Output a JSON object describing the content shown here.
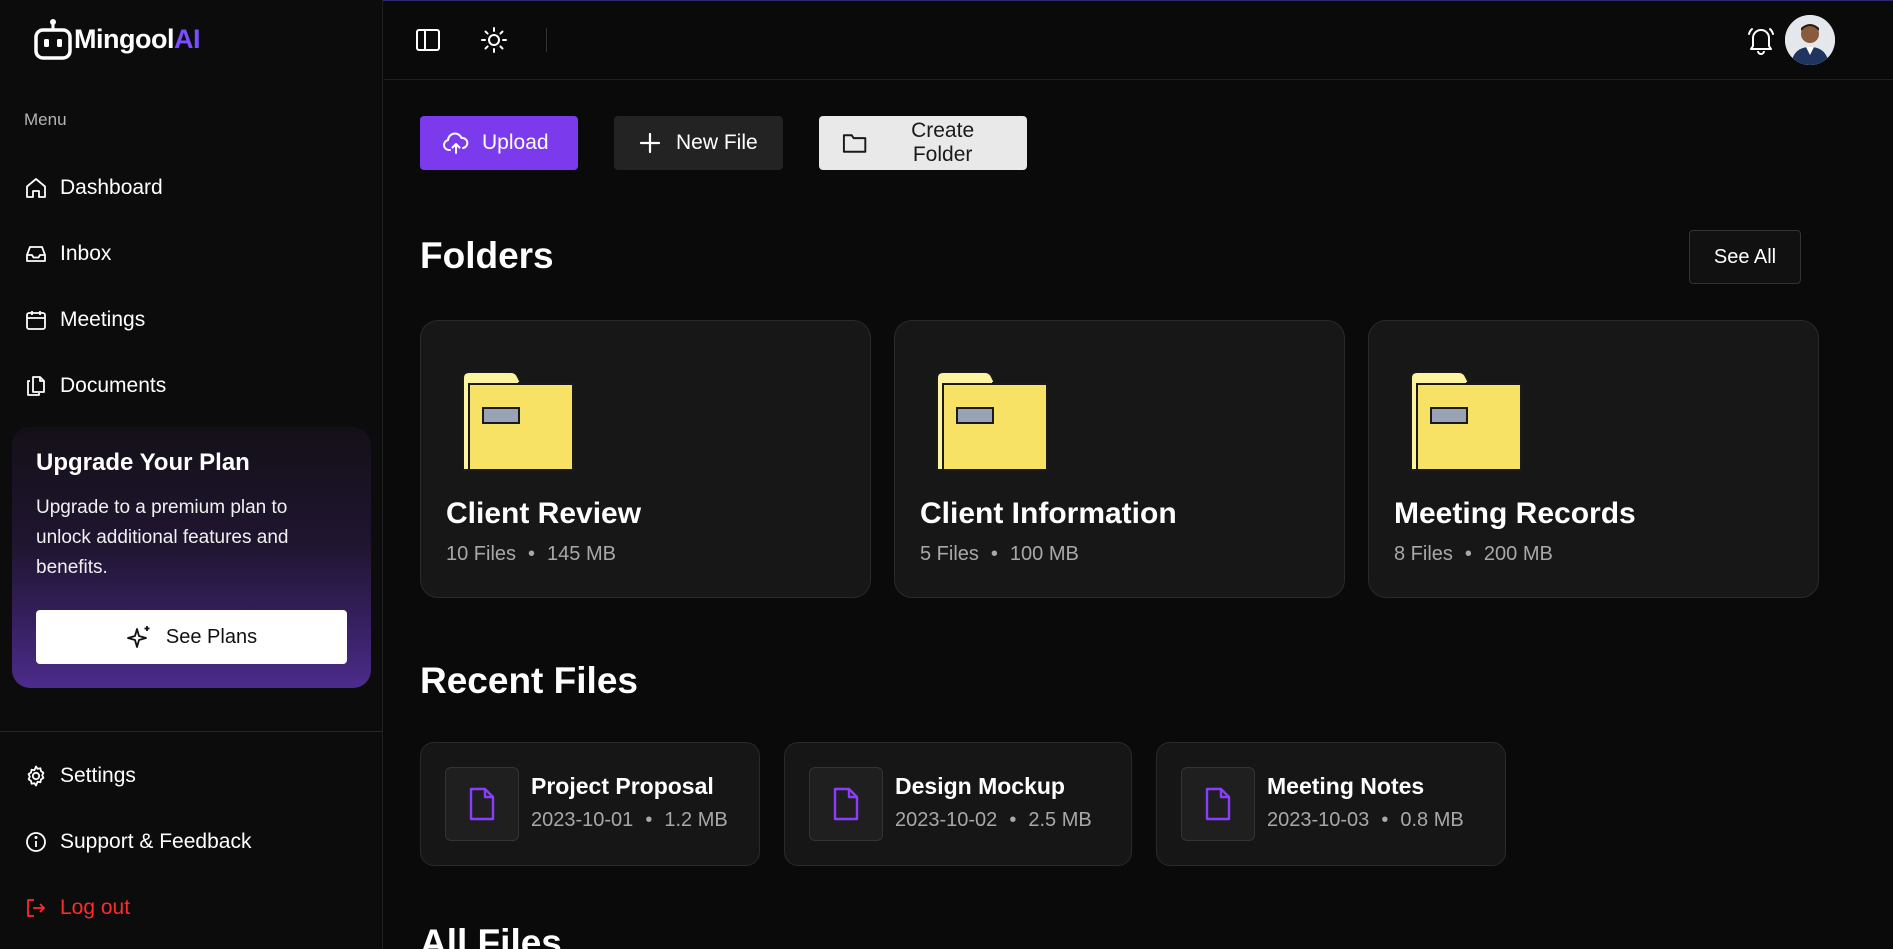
{
  "brand": {
    "name": "Mingool",
    "suffix": "AI"
  },
  "sidebar": {
    "menu_label": "Menu",
    "items": [
      {
        "label": "Dashboard",
        "icon": "home-icon"
      },
      {
        "label": "Inbox",
        "icon": "inbox-icon"
      },
      {
        "label": "Meetings",
        "icon": "calendar-icon"
      },
      {
        "label": "Documents",
        "icon": "documents-icon"
      }
    ],
    "upgrade": {
      "title": "Upgrade Your Plan",
      "text": "Upgrade to a premium plan to unlock additional features and benefits.",
      "button": "See Plans"
    },
    "bottom_items": [
      {
        "label": "Settings",
        "icon": "gear-icon"
      },
      {
        "label": "Support & Feedback",
        "icon": "info-icon"
      },
      {
        "label": "Log out",
        "icon": "logout-icon"
      }
    ]
  },
  "toolbar": {
    "upload": "Upload",
    "new_file": "New File",
    "create_folder": "Create Folder"
  },
  "folders_section": {
    "title": "Folders",
    "see_all": "See All"
  },
  "folders": [
    {
      "name": "Client Review",
      "files": "10 Files",
      "size": "145 MB"
    },
    {
      "name": "Client Information",
      "files": "5 Files",
      "size": "100 MB"
    },
    {
      "name": "Meeting Records",
      "files": "8 Files",
      "size": "200 MB"
    }
  ],
  "recent_section": {
    "title": "Recent Files"
  },
  "recent_files": [
    {
      "name": "Project Proposal",
      "date": "2023-10-01",
      "size": "1.2 MB"
    },
    {
      "name": "Design Mockup",
      "date": "2023-10-02",
      "size": "2.5 MB"
    },
    {
      "name": "Meeting Notes",
      "date": "2023-10-03",
      "size": "0.8 MB"
    }
  ],
  "all_files_section": {
    "title": "All Files"
  },
  "colors": {
    "accent": "#7c3aed",
    "logout": "#ff2a2a",
    "folder": "#f8e268"
  }
}
